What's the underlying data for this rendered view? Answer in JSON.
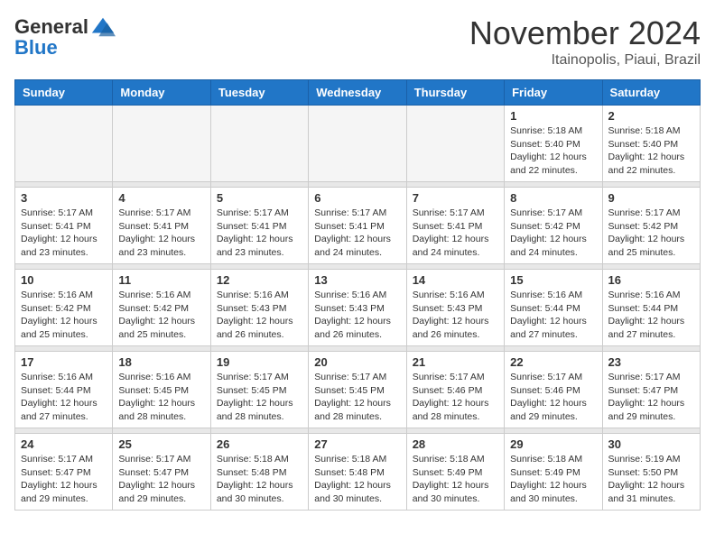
{
  "logo": {
    "general": "General",
    "blue": "Blue"
  },
  "header": {
    "month": "November 2024",
    "location": "Itainopolis, Piaui, Brazil"
  },
  "days_of_week": [
    "Sunday",
    "Monday",
    "Tuesday",
    "Wednesday",
    "Thursday",
    "Friday",
    "Saturday"
  ],
  "weeks": [
    [
      {
        "day": "",
        "empty": true
      },
      {
        "day": "",
        "empty": true
      },
      {
        "day": "",
        "empty": true
      },
      {
        "day": "",
        "empty": true
      },
      {
        "day": "",
        "empty": true
      },
      {
        "day": "1",
        "sunrise": "5:18 AM",
        "sunset": "5:40 PM",
        "daylight": "12 hours and 22 minutes."
      },
      {
        "day": "2",
        "sunrise": "5:18 AM",
        "sunset": "5:40 PM",
        "daylight": "12 hours and 22 minutes."
      }
    ],
    [
      {
        "day": "3",
        "sunrise": "5:17 AM",
        "sunset": "5:41 PM",
        "daylight": "12 hours and 23 minutes."
      },
      {
        "day": "4",
        "sunrise": "5:17 AM",
        "sunset": "5:41 PM",
        "daylight": "12 hours and 23 minutes."
      },
      {
        "day": "5",
        "sunrise": "5:17 AM",
        "sunset": "5:41 PM",
        "daylight": "12 hours and 23 minutes."
      },
      {
        "day": "6",
        "sunrise": "5:17 AM",
        "sunset": "5:41 PM",
        "daylight": "12 hours and 24 minutes."
      },
      {
        "day": "7",
        "sunrise": "5:17 AM",
        "sunset": "5:41 PM",
        "daylight": "12 hours and 24 minutes."
      },
      {
        "day": "8",
        "sunrise": "5:17 AM",
        "sunset": "5:42 PM",
        "daylight": "12 hours and 24 minutes."
      },
      {
        "day": "9",
        "sunrise": "5:17 AM",
        "sunset": "5:42 PM",
        "daylight": "12 hours and 25 minutes."
      }
    ],
    [
      {
        "day": "10",
        "sunrise": "5:16 AM",
        "sunset": "5:42 PM",
        "daylight": "12 hours and 25 minutes."
      },
      {
        "day": "11",
        "sunrise": "5:16 AM",
        "sunset": "5:42 PM",
        "daylight": "12 hours and 25 minutes."
      },
      {
        "day": "12",
        "sunrise": "5:16 AM",
        "sunset": "5:43 PM",
        "daylight": "12 hours and 26 minutes."
      },
      {
        "day": "13",
        "sunrise": "5:16 AM",
        "sunset": "5:43 PM",
        "daylight": "12 hours and 26 minutes."
      },
      {
        "day": "14",
        "sunrise": "5:16 AM",
        "sunset": "5:43 PM",
        "daylight": "12 hours and 26 minutes."
      },
      {
        "day": "15",
        "sunrise": "5:16 AM",
        "sunset": "5:44 PM",
        "daylight": "12 hours and 27 minutes."
      },
      {
        "day": "16",
        "sunrise": "5:16 AM",
        "sunset": "5:44 PM",
        "daylight": "12 hours and 27 minutes."
      }
    ],
    [
      {
        "day": "17",
        "sunrise": "5:16 AM",
        "sunset": "5:44 PM",
        "daylight": "12 hours and 27 minutes."
      },
      {
        "day": "18",
        "sunrise": "5:16 AM",
        "sunset": "5:45 PM",
        "daylight": "12 hours and 28 minutes."
      },
      {
        "day": "19",
        "sunrise": "5:17 AM",
        "sunset": "5:45 PM",
        "daylight": "12 hours and 28 minutes."
      },
      {
        "day": "20",
        "sunrise": "5:17 AM",
        "sunset": "5:45 PM",
        "daylight": "12 hours and 28 minutes."
      },
      {
        "day": "21",
        "sunrise": "5:17 AM",
        "sunset": "5:46 PM",
        "daylight": "12 hours and 28 minutes."
      },
      {
        "day": "22",
        "sunrise": "5:17 AM",
        "sunset": "5:46 PM",
        "daylight": "12 hours and 29 minutes."
      },
      {
        "day": "23",
        "sunrise": "5:17 AM",
        "sunset": "5:47 PM",
        "daylight": "12 hours and 29 minutes."
      }
    ],
    [
      {
        "day": "24",
        "sunrise": "5:17 AM",
        "sunset": "5:47 PM",
        "daylight": "12 hours and 29 minutes."
      },
      {
        "day": "25",
        "sunrise": "5:17 AM",
        "sunset": "5:47 PM",
        "daylight": "12 hours and 29 minutes."
      },
      {
        "day": "26",
        "sunrise": "5:18 AM",
        "sunset": "5:48 PM",
        "daylight": "12 hours and 30 minutes."
      },
      {
        "day": "27",
        "sunrise": "5:18 AM",
        "sunset": "5:48 PM",
        "daylight": "12 hours and 30 minutes."
      },
      {
        "day": "28",
        "sunrise": "5:18 AM",
        "sunset": "5:49 PM",
        "daylight": "12 hours and 30 minutes."
      },
      {
        "day": "29",
        "sunrise": "5:18 AM",
        "sunset": "5:49 PM",
        "daylight": "12 hours and 30 minutes."
      },
      {
        "day": "30",
        "sunrise": "5:19 AM",
        "sunset": "5:50 PM",
        "daylight": "12 hours and 31 minutes."
      }
    ]
  ]
}
